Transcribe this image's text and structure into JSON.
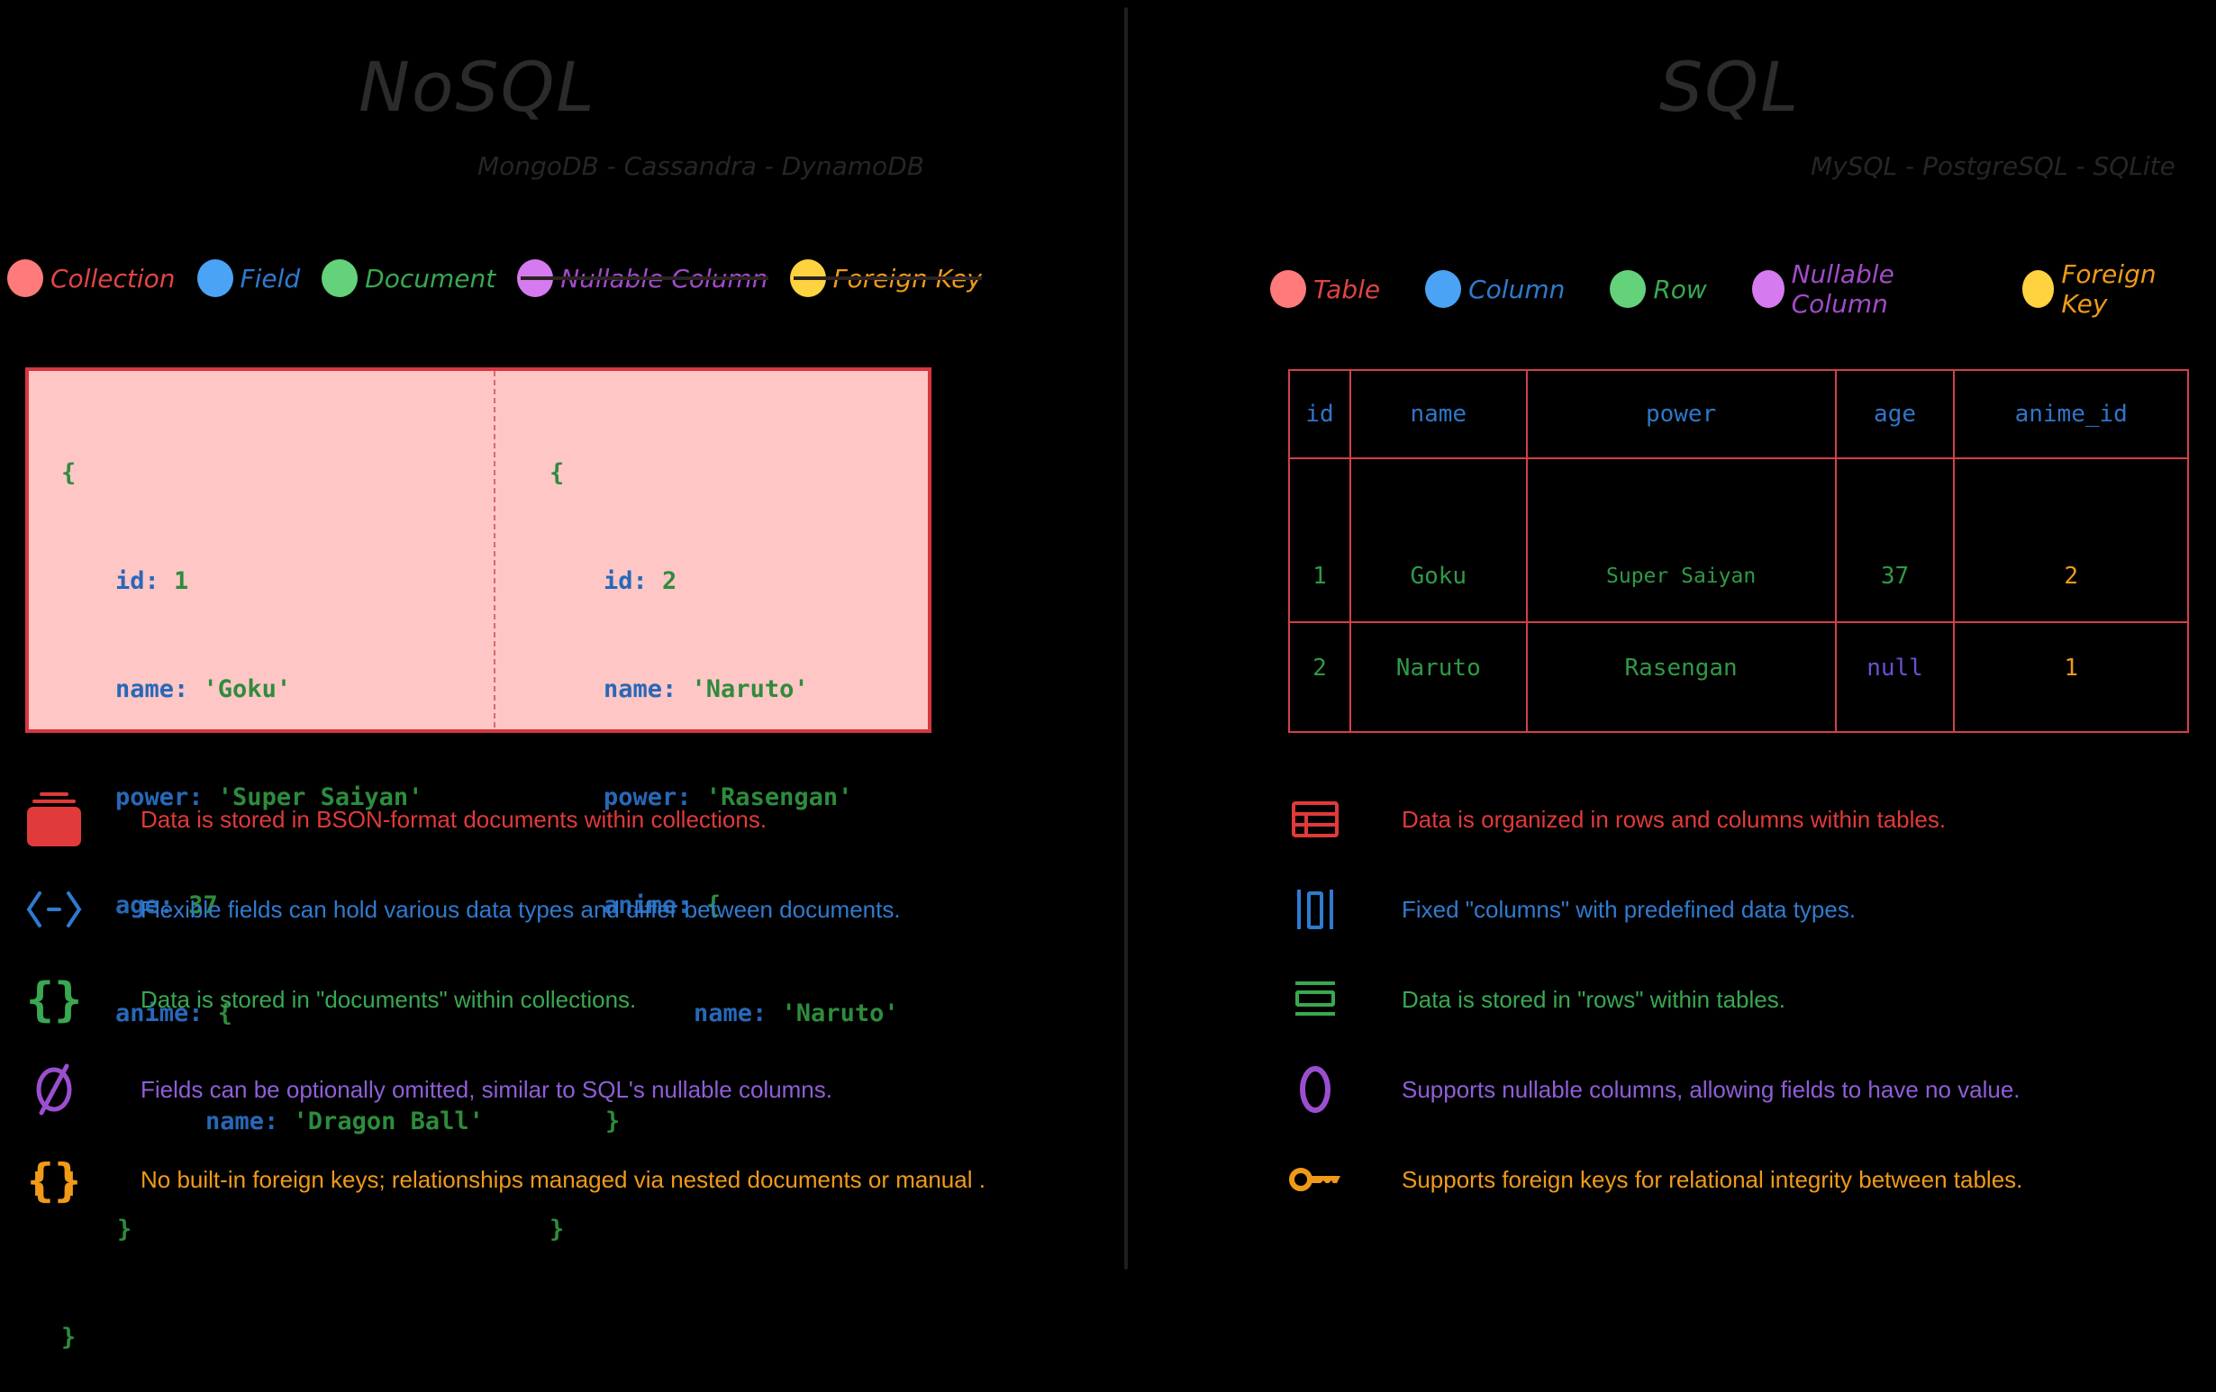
{
  "nosql": {
    "title": "NoSQL",
    "subtitle": "MongoDB - Cassandra - DynamoDB",
    "legend": [
      {
        "label": "Collection",
        "dot_color": "#ff7a7a",
        "text_color": "#e04545",
        "struck": false
      },
      {
        "label": "Field",
        "dot_color": "#4aa3f5",
        "text_color": "#2f7bd0",
        "struck": false
      },
      {
        "label": "Document",
        "dot_color": "#63d27a",
        "text_color": "#39a851",
        "struck": false
      },
      {
        "label": "Nullable Column",
        "dot_color": "#d67af0",
        "text_color": "#a24bc8",
        "struck": true
      },
      {
        "label": "Foreign Key",
        "dot_color": "#ffd23f",
        "text_color": "#f09a19",
        "struck": true
      }
    ],
    "documents": [
      {
        "open": "{",
        "fields": [
          {
            "key": "id",
            "value": "1"
          },
          {
            "key": "name",
            "value": "'Goku'"
          },
          {
            "key": "power",
            "value": "'Super Saiyan'"
          },
          {
            "key": "age",
            "value": "37"
          },
          {
            "key": "anime",
            "value": "{"
          }
        ],
        "nested": {
          "key": "name",
          "value": "'Dragon Ball'"
        },
        "nested_close": "}",
        "close": "}"
      },
      {
        "open": "{",
        "fields": [
          {
            "key": "id",
            "value": "2"
          },
          {
            "key": "name",
            "value": "'Naruto'"
          },
          {
            "key": "power",
            "value": "'Rasengan'"
          },
          {
            "key": "anime",
            "value": "{"
          }
        ],
        "nested": {
          "key": "name",
          "value": "'Naruto'"
        },
        "nested_close": "}",
        "close": "}"
      }
    ],
    "features": [
      {
        "icon": "collection-stack-icon",
        "color": "#e03a3a",
        "text": "Data is stored in BSON-format documents within collections."
      },
      {
        "icon": "code-brackets-icon",
        "color": "#2f7bd0",
        "text": "Flexible fields can hold various data types and differ between documents."
      },
      {
        "icon": "curly-braces-icon",
        "color": "#39a851",
        "text": "Data is stored in \"documents\" within collections."
      },
      {
        "icon": "empty-set-icon",
        "color": "#8f5ed8",
        "text": "Fields can be optionally omitted, similar to SQL's nullable columns."
      },
      {
        "icon": "nested-braces-icon",
        "color": "#f09a19",
        "text": "No built-in foreign keys; relationships managed via nested documents or manual  ."
      }
    ]
  },
  "sql": {
    "title": "SQL",
    "subtitle": "MySQL - PostgreSQL - SQLite",
    "legend": [
      {
        "label": "Table",
        "dot_color": "#ff7a7a",
        "text_color": "#e04545",
        "struck": false
      },
      {
        "label": "Column",
        "dot_color": "#4aa3f5",
        "text_color": "#2f7bd0",
        "struck": false
      },
      {
        "label": "Row",
        "dot_color": "#63d27a",
        "text_color": "#39a851",
        "struck": false
      },
      {
        "label": "Nullable Column",
        "dot_color": "#d67af0",
        "text_color": "#a24bc8",
        "struck": false
      },
      {
        "label": "Foreign Key",
        "dot_color": "#ffd23f",
        "text_color": "#f09a19",
        "struck": false
      }
    ],
    "table": {
      "columns": [
        "id",
        "name",
        "power",
        "age",
        "anime_id"
      ],
      "rows": [
        [
          "1",
          "Goku",
          "Super Saiyan",
          "37",
          "2"
        ],
        [
          "2",
          "Naruto",
          "Rasengan",
          "null",
          "1"
        ]
      ]
    },
    "features": [
      {
        "icon": "table-grid-icon",
        "color": "#e03a3a",
        "text": "Data is organized in rows and columns within tables."
      },
      {
        "icon": "columns-icon",
        "color": "#2f7bd0",
        "text": "Fixed \"columns\" with predefined data types."
      },
      {
        "icon": "rows-icon",
        "color": "#39a851",
        "text": "Data is stored in \"rows\" within tables."
      },
      {
        "icon": "zero-null-icon",
        "color": "#8f5ed8",
        "text": "Supports nullable columns, allowing fields to have no value."
      },
      {
        "icon": "key-icon",
        "color": "#f09a19",
        "text": "Supports foreign keys for relational integrity between tables."
      }
    ]
  }
}
